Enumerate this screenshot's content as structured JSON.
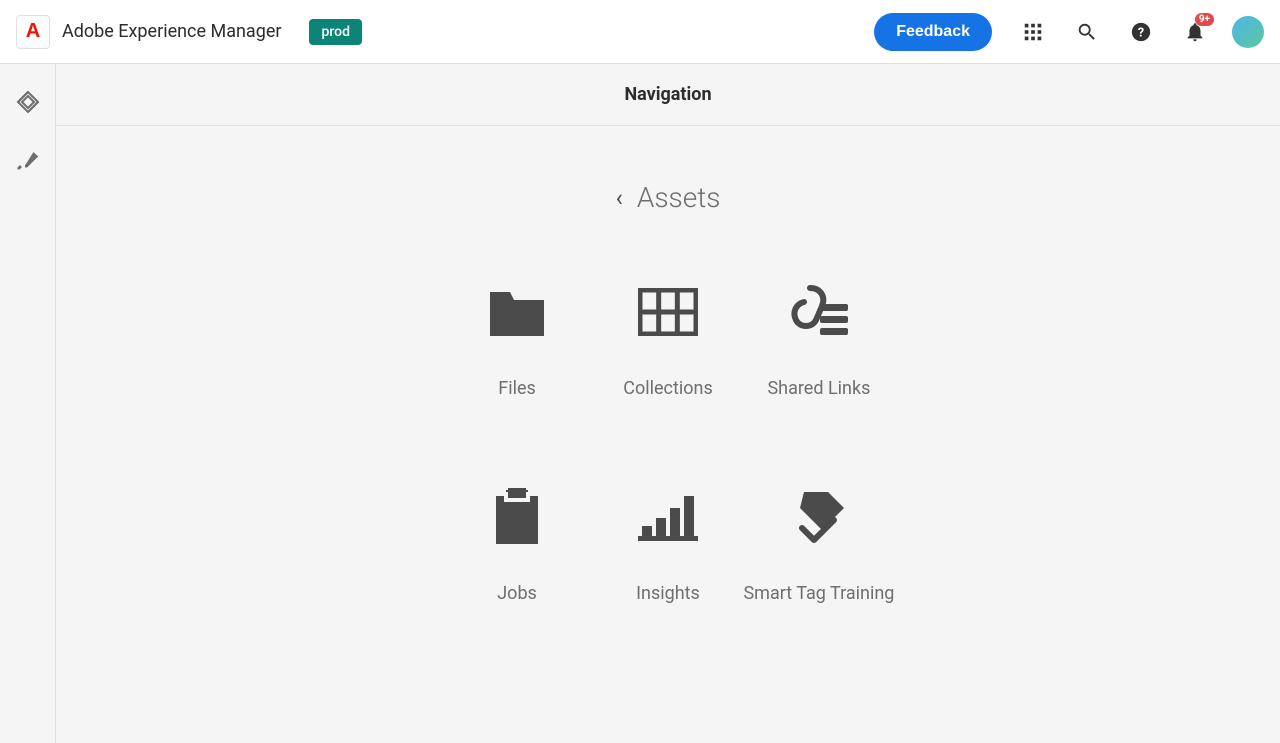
{
  "header": {
    "app_title": "Adobe Experience Manager",
    "env_badge": "prod",
    "feedback_label": "Feedback",
    "notification_badge": "9+"
  },
  "main": {
    "nav_title": "Navigation",
    "section_title": "Assets"
  },
  "grid": {
    "items": [
      {
        "label": "Files"
      },
      {
        "label": "Collections"
      },
      {
        "label": "Shared Links"
      },
      {
        "label": "Jobs"
      },
      {
        "label": "Insights"
      },
      {
        "label": "Smart Tag Training"
      }
    ]
  }
}
